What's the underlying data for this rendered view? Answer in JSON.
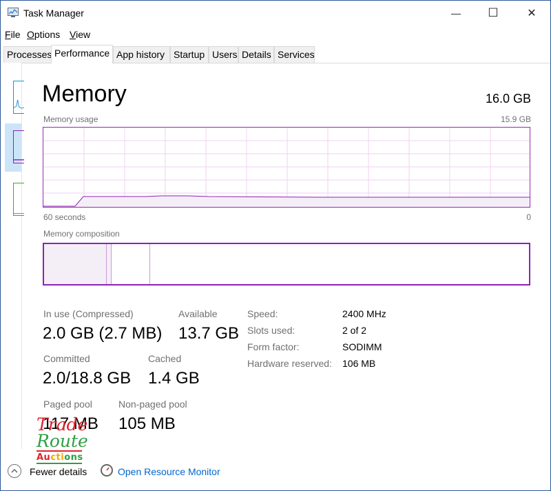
{
  "window": {
    "title": "Task Manager",
    "controls": {
      "minimize": "—",
      "maximize": "☐",
      "close": "✕"
    }
  },
  "menu": [
    {
      "label": "File",
      "key": "F",
      "rest": "ile"
    },
    {
      "label": "Options",
      "key": "O",
      "rest": "ptions"
    },
    {
      "label": "View",
      "key": "V",
      "rest": "iew"
    }
  ],
  "tabs": [
    "Processes",
    "Performance",
    "App history",
    "Startup",
    "Users",
    "Details",
    "Services"
  ],
  "active_tab": "Performance",
  "sidebar_colors": {
    "cpu": "#1e8fd6",
    "memory": "#8e21b4",
    "disk": "#4da60c"
  },
  "memory": {
    "title": "Memory",
    "total": "16.0 GB",
    "usage_label": "Memory usage",
    "usage_max": "15.9 GB",
    "axis_left": "60 seconds",
    "axis_right": "0",
    "composition_label": "Memory composition",
    "stats": {
      "in_use_label": "In use (Compressed)",
      "in_use_value": "2.0 GB (2.7 MB)",
      "available_label": "Available",
      "available_value": "13.7 GB",
      "committed_label": "Committed",
      "committed_value": "2.0/18.8 GB",
      "cached_label": "Cached",
      "cached_value": "1.4 GB",
      "paged_label": "Paged pool",
      "paged_value": "117 MB",
      "nonpaged_label": "Non-paged pool",
      "nonpaged_value": "105 MB"
    },
    "details": {
      "speed_key": "Speed:",
      "speed_val": "2400 MHz",
      "slots_key": "Slots used:",
      "slots_val": "2 of 2",
      "form_key": "Form factor:",
      "form_val": "SODIMM",
      "hw_key": "Hardware reserved:",
      "hw_val": "106 MB"
    },
    "accent_color": "#8e21b4"
  },
  "footer": {
    "fewer_details": "Fewer details",
    "open_resource_monitor": "Open Resource Monitor"
  },
  "watermark": {
    "line1": "Trade",
    "line2": "Route",
    "line3": "Auctions"
  }
}
